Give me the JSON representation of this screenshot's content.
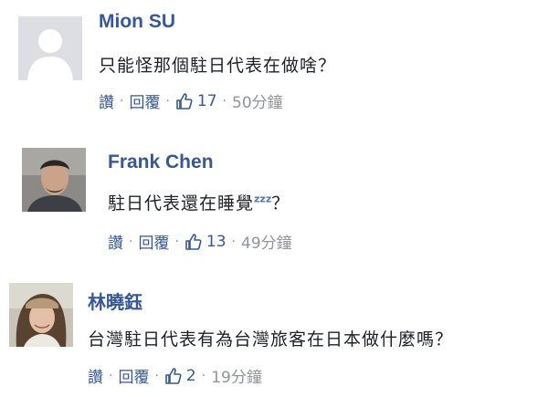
{
  "comments": [
    {
      "author": "Mion SU",
      "text": "只能怪那個駐日代表在做啥？",
      "read_label": "讚",
      "reply_label": "回覆",
      "like_count": "17",
      "time": "50分鐘",
      "avatar": "default-silhouette"
    },
    {
      "author": "Frank Chen",
      "text": "駐日代表還在睡覺",
      "text_suffix": "？",
      "sleep_emoji": "zzz",
      "read_label": "讚",
      "reply_label": "回覆",
      "like_count": "13",
      "time": "49分鐘",
      "avatar": "man-photo"
    },
    {
      "author": "林曉鈺",
      "text": "台灣駐日代表有為台灣旅客在日本做什麼嗎？",
      "read_label": "讚",
      "reply_label": "回覆",
      "like_count": "2",
      "time": "19分鐘",
      "avatar": "woman-photo"
    }
  ],
  "colors": {
    "link": "#365899",
    "text": "#1d2129",
    "meta": "#90949c"
  }
}
